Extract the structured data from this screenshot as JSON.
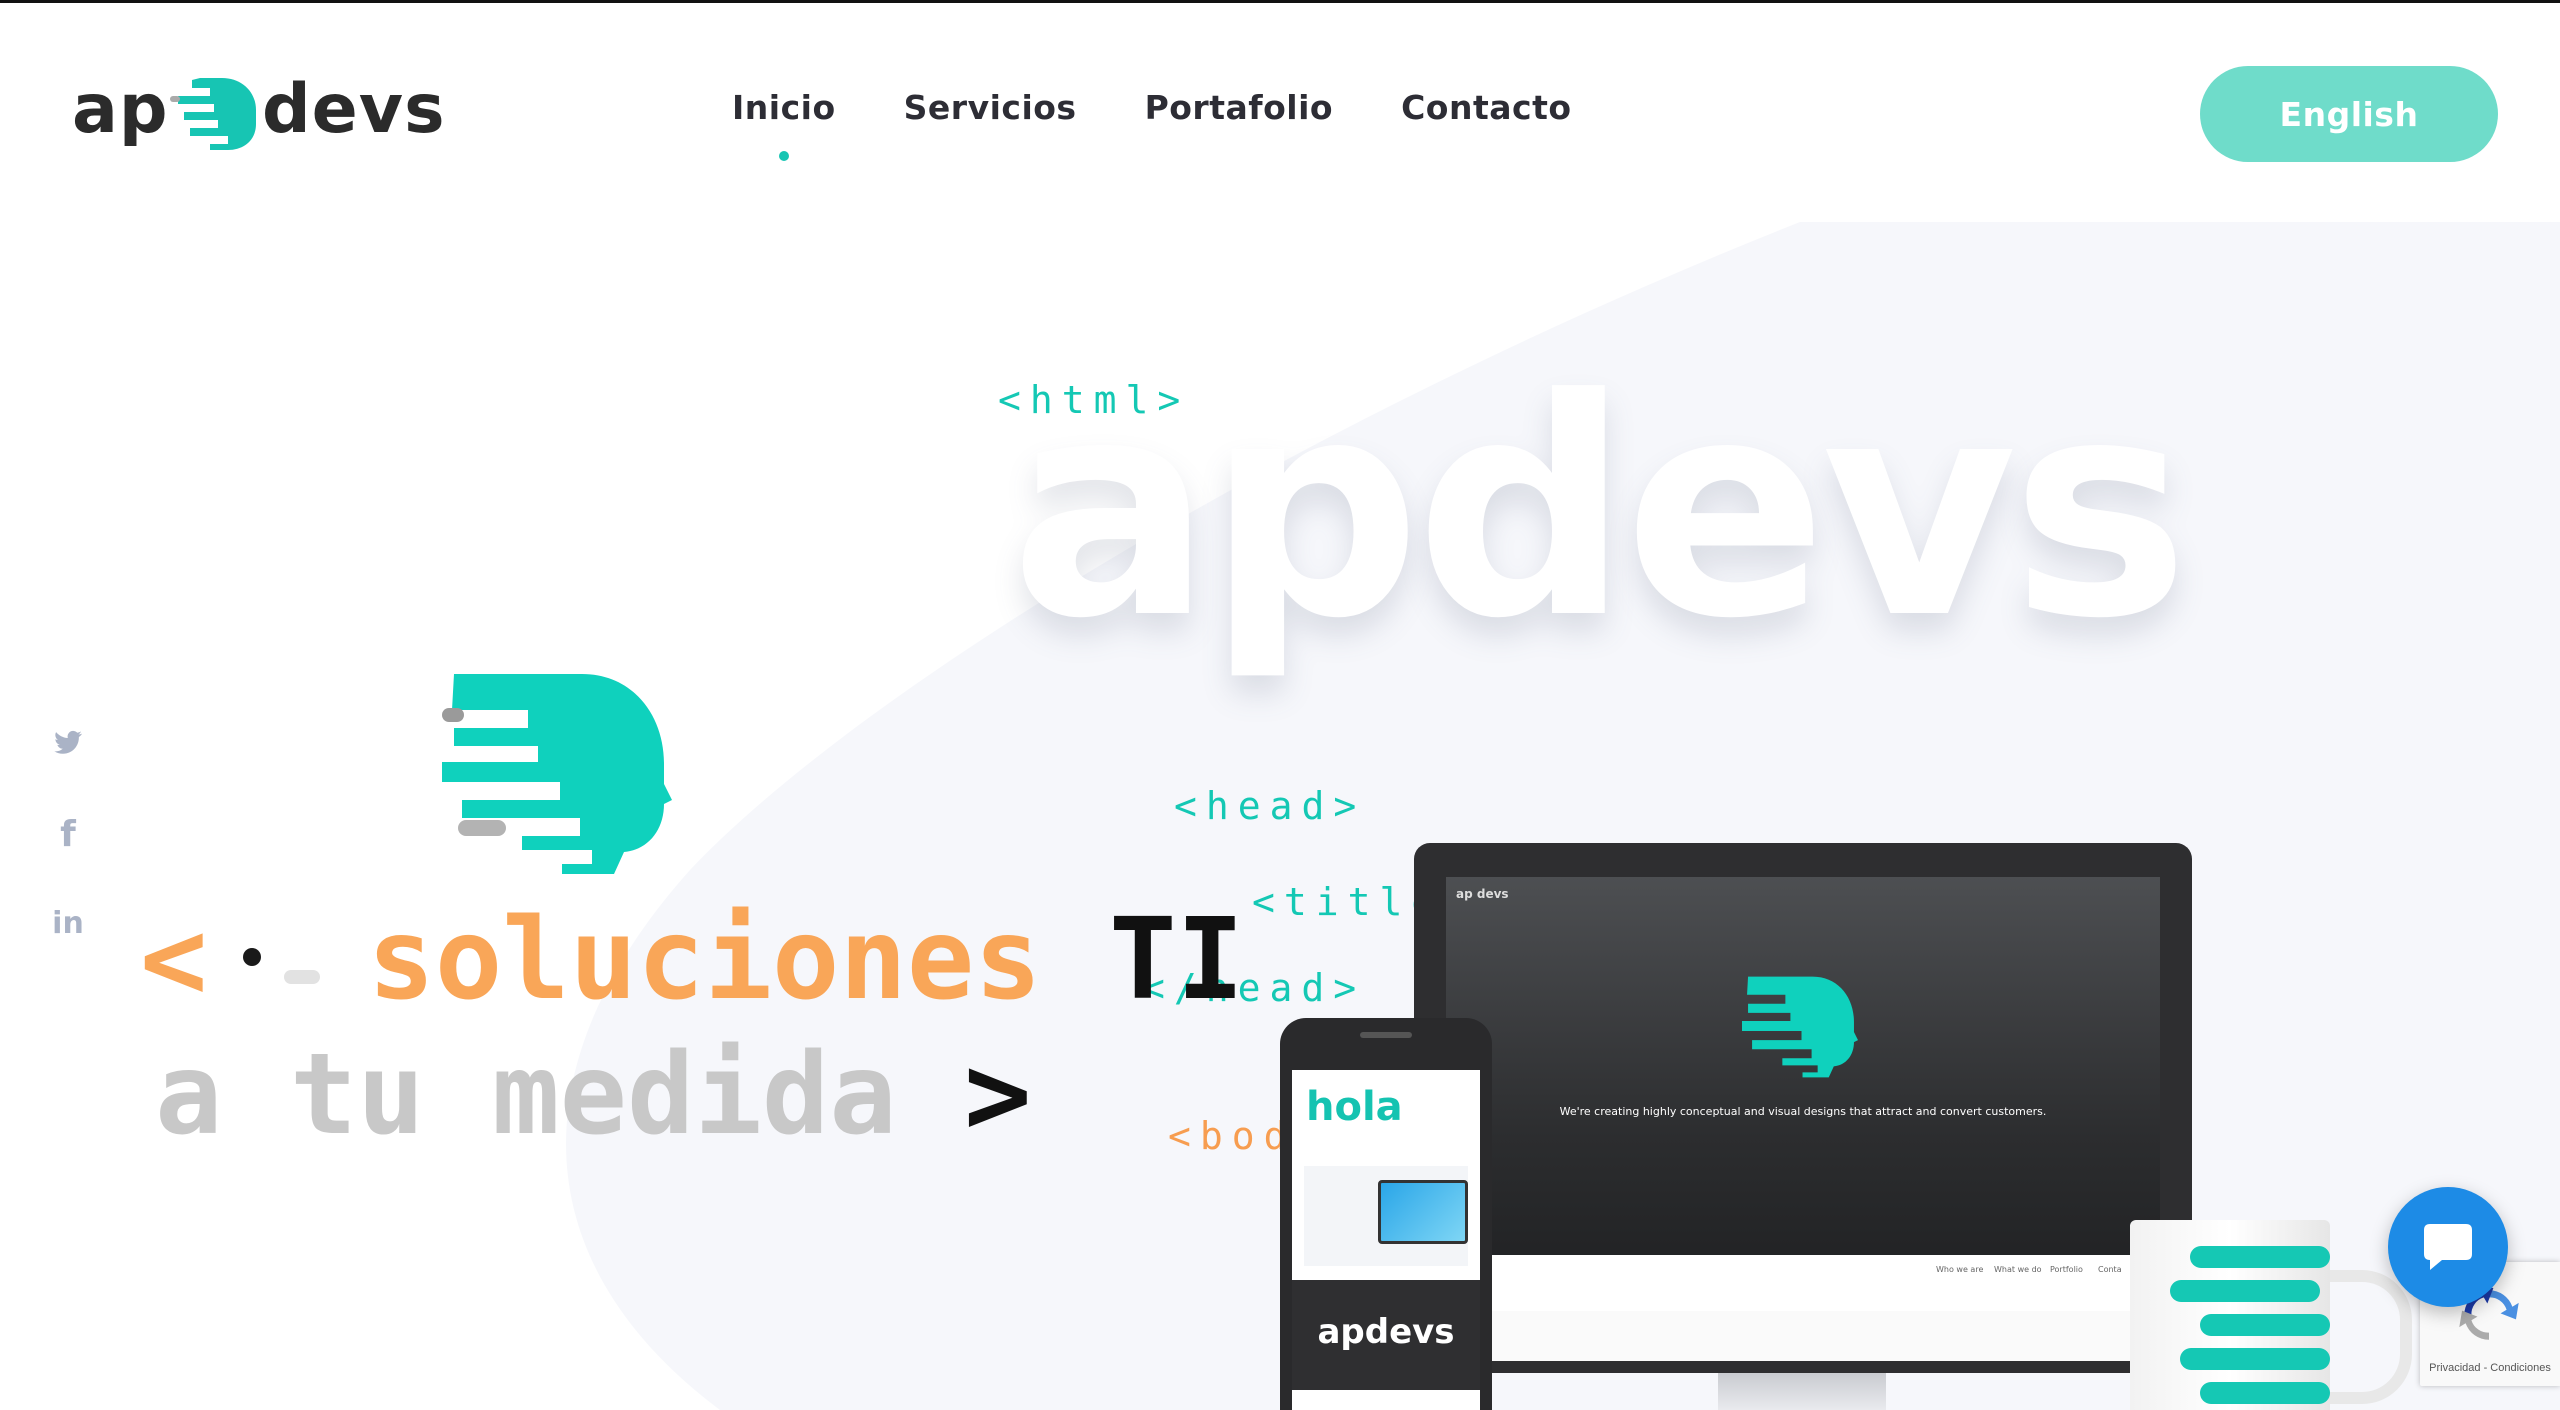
{
  "colors": {
    "accent": "#17c5b3",
    "orange": "#f9a658",
    "button": "#6fdcca",
    "text_dark": "#2d2d35",
    "chat": "#1d8be6"
  },
  "header": {
    "logo": {
      "left": "ap",
      "right": "devs",
      "icon": "face-lines-icon"
    },
    "nav": [
      {
        "label": "Inicio",
        "active": true
      },
      {
        "label": "Servicios",
        "active": false
      },
      {
        "label": "Portafolio",
        "active": false
      },
      {
        "label": "Contacto",
        "active": false
      }
    ],
    "language_button": "English"
  },
  "social": [
    {
      "icon": "twitter-icon",
      "glyph": "🐦"
    },
    {
      "icon": "facebook-icon",
      "glyph": "f"
    },
    {
      "icon": "linkedin-icon",
      "glyph": "in"
    }
  ],
  "hero": {
    "big_word": "apdevs",
    "code_tags": {
      "html": "<html>",
      "head": "<head>",
      "title": "<title>",
      "head_close": "</head>",
      "body": "<bod"
    },
    "line1": {
      "open": "<",
      "word": "soluciones",
      "ti": "TI"
    },
    "line2": {
      "text": "a tu medida",
      "close": ">"
    }
  },
  "mockups": {
    "monitor": {
      "logo": "ap devs",
      "tagline": "We're creating highly conceptual and visual designs that attract and convert customers.",
      "menu": [
        "Who we are",
        "What we do",
        "Portfolio",
        "Conta"
      ]
    },
    "phone": {
      "hello": "hola",
      "brand": "apdevs"
    }
  },
  "recaptcha": {
    "text": "Privacidad - Condiciones"
  },
  "chat": {
    "icon": "chat-bubble-icon"
  }
}
